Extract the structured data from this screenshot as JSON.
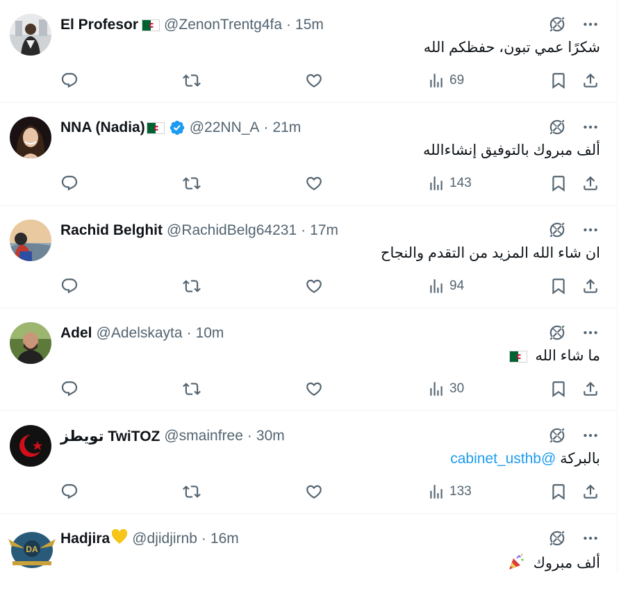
{
  "tweets": [
    {
      "name": "El Profesor",
      "handle": "@ZenonTrentg4fa",
      "time": "15m",
      "text": "شكرًا عمي تبون، حفظكم الله",
      "views": "69"
    },
    {
      "name": "NNA (Nadia)",
      "handle": "@22NN_A",
      "time": "21m",
      "text": "ألف مبروك بالتوفيق إنشاءالله",
      "views": "143"
    },
    {
      "name": "Rachid Belghit",
      "handle": "@RachidBelg64231",
      "time": "17m",
      "text": "ان شاء الله المزيد من التقدم والنجاح",
      "views": "94"
    },
    {
      "name": "Adel",
      "handle": "@Adelskayta",
      "time": "10m",
      "text": "ما شاء الله",
      "views": "30"
    },
    {
      "name": "تويطز TwiTOZ",
      "handle": "@smainfree",
      "time": "30m",
      "text": "بالبركة",
      "mention": "@cabinet_usthb",
      "views": "133"
    },
    {
      "name": "Hadjira",
      "handle": "@djidjirnb",
      "time": "16m",
      "text": "ألف مبروك",
      "views": ""
    }
  ],
  "avatar_logo_text": "DA",
  "colors": {
    "text_primary": "#0f1419",
    "text_secondary": "#536471",
    "link": "#1d9bf0",
    "verified": "#1d9bf0",
    "divider": "#eff3f4"
  },
  "icons": [
    "reply-icon",
    "retweet-icon",
    "like-icon",
    "views-icon",
    "bookmark-icon",
    "share-icon",
    "grok-icon",
    "more-icon",
    "verified-badge-icon",
    "algeria-flag-icon",
    "yellow-heart-icon",
    "party-popper-icon"
  ]
}
